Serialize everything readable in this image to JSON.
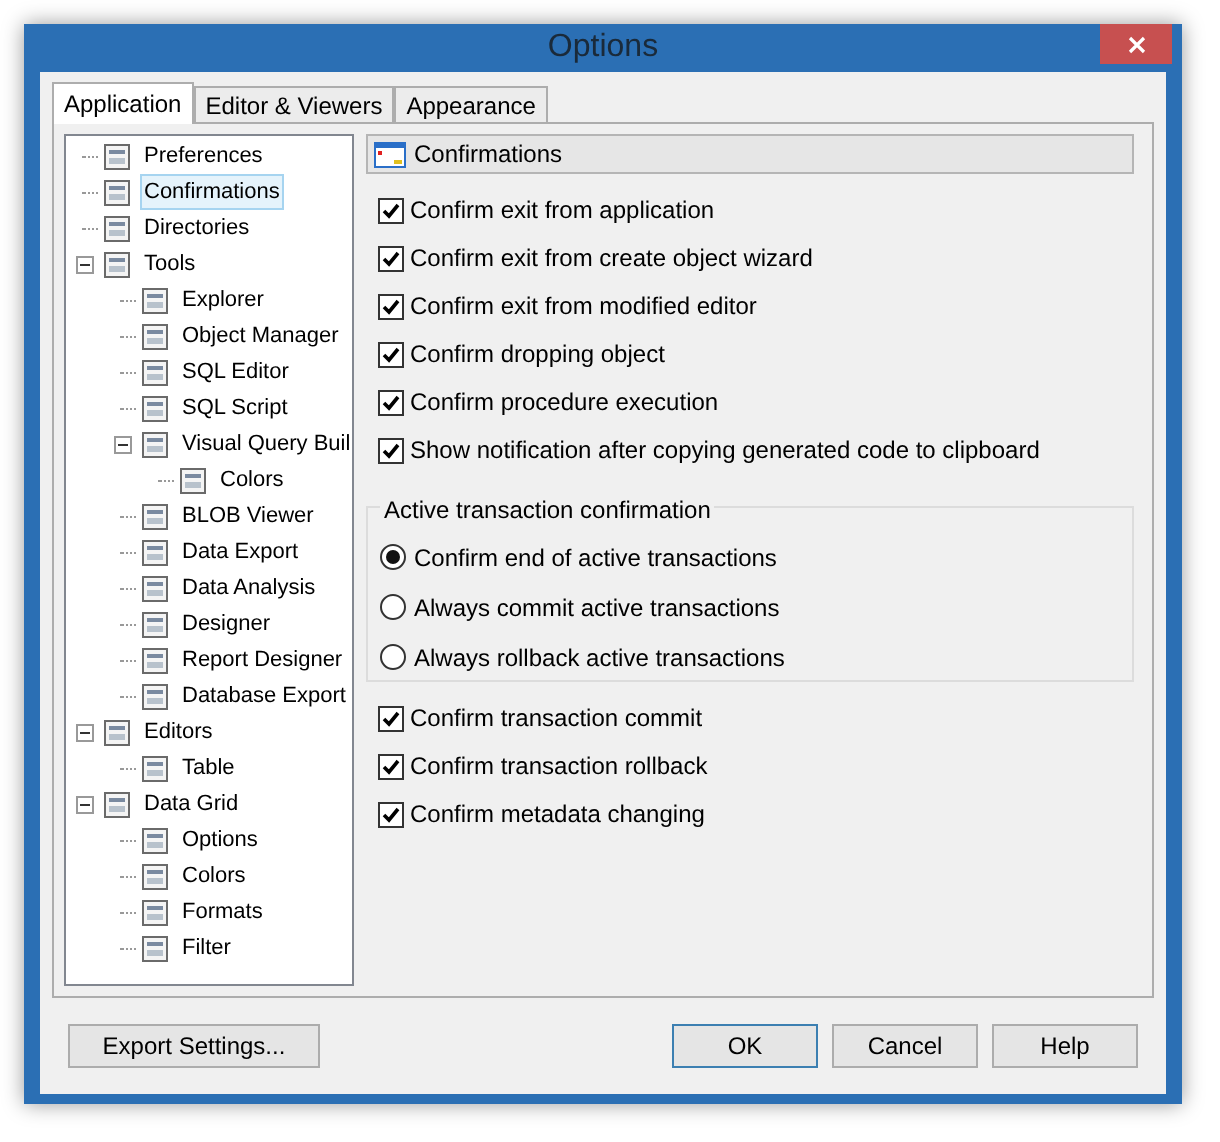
{
  "window": {
    "title": "Options"
  },
  "tabs": [
    {
      "label": "Application",
      "selected": true
    },
    {
      "label": "Editor & Viewers",
      "selected": false
    },
    {
      "label": "Appearance",
      "selected": false
    }
  ],
  "tree": [
    {
      "label": "Preferences",
      "selected": false
    },
    {
      "label": "Confirmations",
      "selected": true
    },
    {
      "label": "Directories",
      "selected": false
    },
    {
      "label": "Tools",
      "selected": false,
      "expanded": true,
      "children": [
        {
          "label": "Explorer",
          "selected": false
        },
        {
          "label": "Object Manager",
          "selected": false
        },
        {
          "label": "SQL Editor",
          "selected": false
        },
        {
          "label": "SQL Script",
          "selected": false
        },
        {
          "label": "Visual Query Buil",
          "selected": false,
          "expanded": true,
          "children": [
            {
              "label": "Colors",
              "selected": false
            }
          ]
        },
        {
          "label": "BLOB Viewer",
          "selected": false
        },
        {
          "label": "Data Export",
          "selected": false
        },
        {
          "label": "Data Analysis",
          "selected": false
        },
        {
          "label": "Designer",
          "selected": false
        },
        {
          "label": "Report Designer",
          "selected": false
        },
        {
          "label": "Database Export",
          "selected": false
        }
      ]
    },
    {
      "label": "Editors",
      "selected": false,
      "expanded": true,
      "children": [
        {
          "label": "Table",
          "selected": false
        }
      ]
    },
    {
      "label": "Data Grid",
      "selected": false,
      "expanded": true,
      "children": [
        {
          "label": "Options",
          "selected": false
        },
        {
          "label": "Colors",
          "selected": false
        },
        {
          "label": "Formats",
          "selected": false
        },
        {
          "label": "Filter",
          "selected": false
        }
      ]
    }
  ],
  "panel": {
    "title": "Confirmations",
    "checks": [
      {
        "label": "Confirm exit from application",
        "checked": true
      },
      {
        "label": "Confirm exit from create object wizard",
        "checked": true
      },
      {
        "label": "Confirm exit from modified editor",
        "checked": true
      },
      {
        "label": "Confirm dropping object",
        "checked": true
      },
      {
        "label": "Confirm procedure execution",
        "checked": true
      },
      {
        "label": "Show notification after copying generated code to clipboard",
        "checked": true
      }
    ],
    "group": {
      "title": "Active transaction confirmation",
      "options": [
        {
          "label": "Confirm end of active transactions",
          "selected": true
        },
        {
          "label": "Always commit active transactions",
          "selected": false
        },
        {
          "label": "Always rollback active transactions",
          "selected": false
        }
      ]
    },
    "checks2": [
      {
        "label": "Confirm transaction commit",
        "checked": true
      },
      {
        "label": "Confirm transaction rollback",
        "checked": true
      },
      {
        "label": "Confirm metadata changing",
        "checked": true
      }
    ]
  },
  "buttons": {
    "export": "Export Settings...",
    "ok": "OK",
    "cancel": "Cancel",
    "help": "Help"
  }
}
